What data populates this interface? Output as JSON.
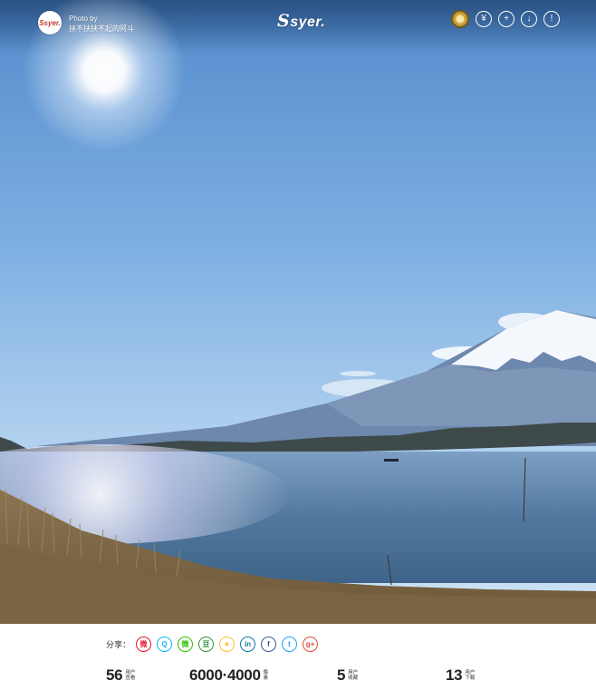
{
  "header": {
    "avatar_text": "Ssyer.",
    "photo_by_label": "Photo by",
    "author": "扶不扶扶不起的阿斗",
    "logo_mark": "S",
    "logo_text": "syer."
  },
  "toolbar": {
    "sponsor_icon_glyph": "¥",
    "add_icon_glyph": "+",
    "download_icon_glyph": "↓",
    "report_icon_glyph": "!"
  },
  "share": {
    "label": "分享：",
    "buttons": [
      {
        "name": "weibo-share-icon",
        "glyph": "微",
        "color": "#e6162d"
      },
      {
        "name": "qq-share-icon",
        "glyph": "Q",
        "color": "#12b7f5"
      },
      {
        "name": "wechat-share-icon",
        "glyph": "微",
        "color": "#2dc100"
      },
      {
        "name": "douban-share-icon",
        "glyph": "豆",
        "color": "#2e963d"
      },
      {
        "name": "qzone-share-icon",
        "glyph": "★",
        "color": "#fdbe3d"
      },
      {
        "name": "linkedin-share-icon",
        "glyph": "in",
        "color": "#0e76a8"
      },
      {
        "name": "facebook-share-icon",
        "glyph": "f",
        "color": "#3b5998"
      },
      {
        "name": "twitter-share-icon",
        "glyph": "t",
        "color": "#1da1f2"
      },
      {
        "name": "googleplus-share-icon",
        "glyph": "g+",
        "color": "#dd4b39"
      }
    ]
  },
  "stats": {
    "views": {
      "value": "56",
      "label": "用户查看"
    },
    "pixels": {
      "value": "6000·4000",
      "label": "像素"
    },
    "favorites": {
      "value": "5",
      "label": "用户收藏"
    },
    "downloads": {
      "value": "13",
      "label": "用户下载"
    }
  }
}
